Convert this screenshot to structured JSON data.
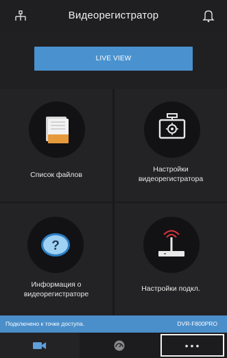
{
  "header": {
    "title": "Видеорегистратор",
    "left_icon": "network-tree-icon",
    "right_icon": "bell-icon"
  },
  "live_view": {
    "label": "LIVE VIEW"
  },
  "menu": [
    {
      "label": "Список файлов",
      "icon": "file-list-icon"
    },
    {
      "label_line1": "Настройки",
      "label_line2": "видеорегистратора",
      "icon": "dashcam-settings-icon"
    },
    {
      "label_line1": "Информация о",
      "label_line2": "видеорегистраторе",
      "icon": "help-icon"
    },
    {
      "label": "Настройки подкл.",
      "icon": "router-icon"
    }
  ],
  "status_bar": {
    "text": "Подключено к точке доступа.",
    "device": "DVR-F800PRO"
  },
  "tabs": [
    {
      "icon": "video-camera-icon"
    },
    {
      "icon": "gauge-icon"
    },
    {
      "label": "•••",
      "icon": "more-icon"
    }
  ],
  "colors": {
    "accent": "#4a92cf",
    "background": "#1c1c1e"
  }
}
